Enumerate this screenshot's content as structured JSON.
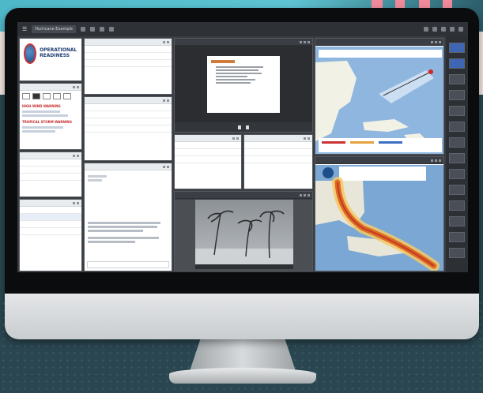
{
  "app": {
    "menu_label": "☰",
    "workspace_label": "Hurricane Example"
  },
  "logo": {
    "title": "OPERATIONAL READINESS"
  },
  "notices": {
    "line1": "HIGH WIND WARNING",
    "line2": "TROPICAL STORM WARNING"
  },
  "colors": {
    "accent": "#1f3d73",
    "warning": "#c62828",
    "map_water": "#7aa7d4",
    "cone": "#e06a1e"
  },
  "icons": [
    "menu-icon",
    "chevron-down-icon",
    "play-icon",
    "pause-icon",
    "close-icon"
  ]
}
